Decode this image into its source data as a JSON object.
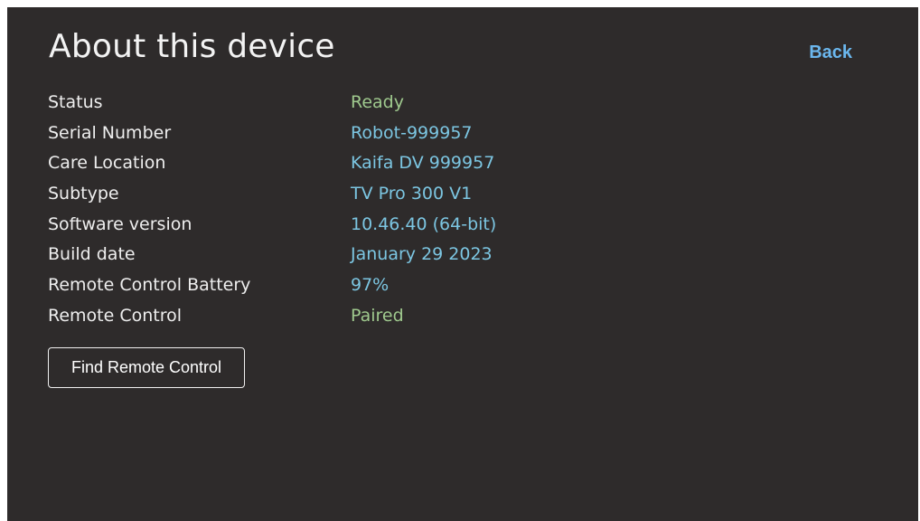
{
  "header": {
    "title": "About this device",
    "back_label": "Back"
  },
  "info": [
    {
      "label": "Status",
      "value": "Ready"
    },
    {
      "label": "Serial Number",
      "value": "Robot-999957"
    },
    {
      "label": "Care Location",
      "value": "Kaifa DV 999957"
    },
    {
      "label": "Subtype",
      "value": "TV Pro 300 V1"
    },
    {
      "label": "Software version",
      "value": "10.46.40 (64-bit)"
    },
    {
      "label": "Build date",
      "value": "January 29 2023"
    },
    {
      "label": "Remote Control Battery",
      "value": "97%"
    },
    {
      "label": "Remote Control",
      "value": "Paired"
    }
  ],
  "actions": {
    "find_remote_label": "Find Remote Control"
  },
  "colors": {
    "background": "#2e2b2b",
    "label_text": "#eeeeee",
    "status_green": "#9fc98e",
    "value_blue": "#7cc6e2",
    "link_blue": "#6bb7ee"
  }
}
